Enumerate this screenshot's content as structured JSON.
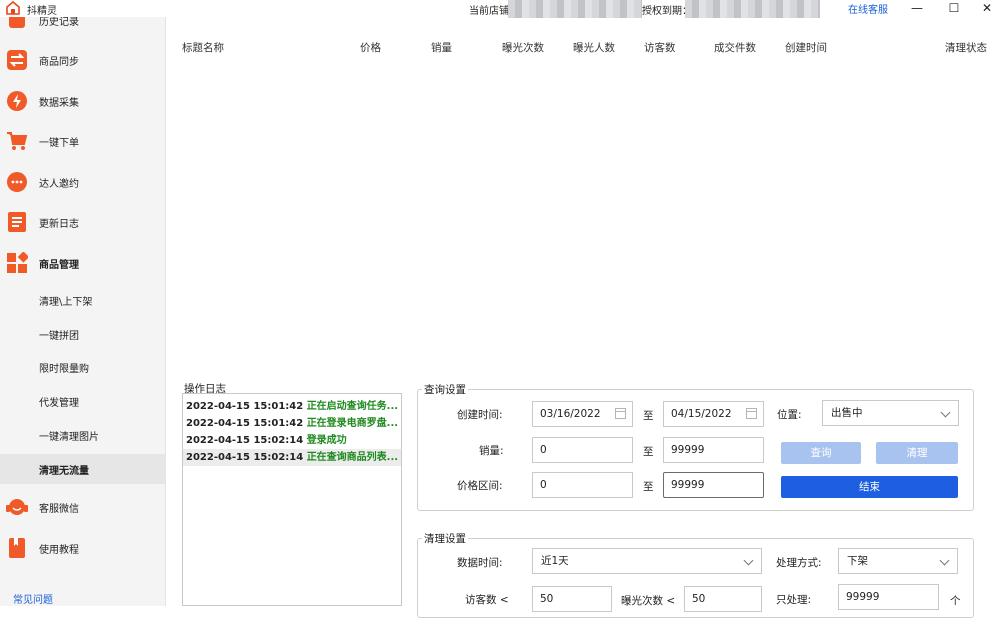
{
  "titlebar": {
    "app_name": "抖精灵",
    "store_label": "当前店铺",
    "expiry_label": "授权到期：",
    "service_link": "在线客服",
    "minimize": "—",
    "maximize": "☐",
    "close": "✕"
  },
  "sidebar": {
    "items": [
      {
        "label": "历史记录",
        "icon": "history-icon"
      },
      {
        "label": "商品同步",
        "icon": "sync-icon"
      },
      {
        "label": "数据采集",
        "icon": "lightning-icon"
      },
      {
        "label": "一键下单",
        "icon": "cart-icon"
      },
      {
        "label": "达人邀约",
        "icon": "chat-icon"
      },
      {
        "label": "更新日志",
        "icon": "list-icon"
      },
      {
        "label": "商品管理",
        "icon": "grid-icon"
      }
    ],
    "subitems": [
      "清理\\上下架",
      "一键拼团",
      "限时限量购",
      "代发管理",
      "一键清理图片",
      "清理无流量"
    ],
    "bottom_items": [
      {
        "label": "客服微信",
        "icon": "headset-icon"
      },
      {
        "label": "使用教程",
        "icon": "book-icon"
      }
    ],
    "faq": "常见问题",
    "accent_color": "#f05a28"
  },
  "table": {
    "columns": [
      "标题名称",
      "价格",
      "销量",
      "曝光次数",
      "曝光人数",
      "访客数",
      "成交件数",
      "创建时间",
      "清理状态"
    ]
  },
  "log": {
    "title": "操作日志",
    "entries": [
      {
        "time": "2022-04-15 15:01:42",
        "msg": "正在启动查询任务..."
      },
      {
        "time": "2022-04-15 15:01:42",
        "msg": "正在登录电商罗盘..."
      },
      {
        "time": "2022-04-15 15:02:14",
        "msg": "登录成功"
      },
      {
        "time": "2022-04-15 15:02:14",
        "msg": "正在查询商品列表..."
      }
    ]
  },
  "query": {
    "title": "查询设置",
    "created_label": "创建时间:",
    "created_from": "03/16/2022",
    "created_to": "04/15/2022",
    "to_label": "至",
    "sales_label": "销量:",
    "sales_from": "0",
    "sales_to": "99999",
    "price_label": "价格区间:",
    "price_from": "0",
    "price_to": "99999",
    "position_label": "位置:",
    "position_value": "出售中",
    "search_btn": "查询",
    "clean_btn": "清理",
    "end_btn": "结束"
  },
  "clean": {
    "title": "清理设置",
    "data_time_label": "数据时间:",
    "data_time_value": "近1天",
    "method_label": "处理方式:",
    "method_value": "下架",
    "visitors_label": "访客数 <",
    "visitors_value": "50",
    "exposure_label": "曝光次数 <",
    "exposure_value": "50",
    "only_label": "只处理:",
    "only_value": "99999",
    "unit": "个"
  }
}
